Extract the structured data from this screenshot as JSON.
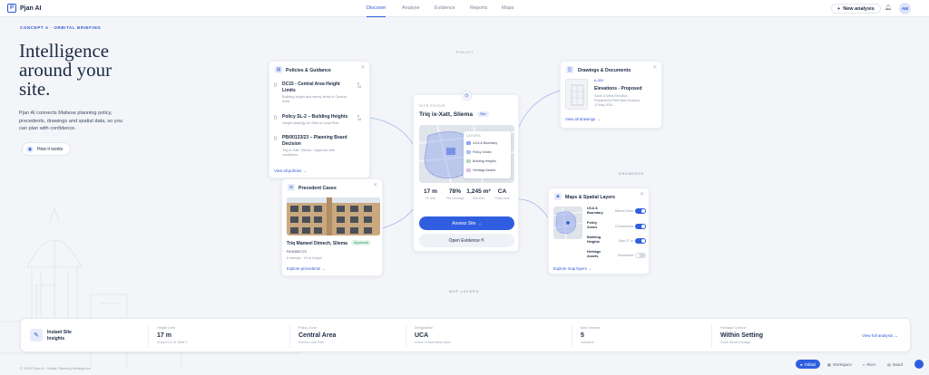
{
  "brand": {
    "name": "Pjan AI",
    "mark": "P"
  },
  "nav": [
    {
      "label": "Discover"
    },
    {
      "label": "Analyse"
    },
    {
      "label": "Evidence"
    },
    {
      "label": "Reports"
    },
    {
      "label": "Maps"
    }
  ],
  "header": {
    "new_analysis": "New analysis",
    "avatar": "AM"
  },
  "hero": {
    "eyebrow": "CONCEPT A · ORBITAL BRIEFING",
    "title": "Intelligence around your site.",
    "lede": "Pjan AI connects Maltese planning policy, precedents, drawings and spatial data, so you can plan with confidence.",
    "cta": "How it works"
  },
  "labels": {
    "policy": "POLICY",
    "drawings": "DRAWINGS",
    "map_layers": "MAP LAYERS"
  },
  "policies": {
    "title": "Policies & Guidance",
    "items": [
      {
        "title": "DC15 - Central Area Height Limits",
        "sub": "Building height and storey limits in Central Area",
        "tag": "p. 28"
      },
      {
        "title": "Policy SL-2 – Building Heights",
        "sub": "Height strategy for Sliema Local Plan",
        "tag": "p. 48"
      },
      {
        "title": "PB/00133/23 – Planning Board Decision",
        "sub": "Triq in-Xatt, Sliema · Approval with conditions",
        "tag": ""
      }
    ],
    "link": "View all policies"
  },
  "precedents": {
    "title": "Precedent Cases",
    "address": "Triq Manwel Dimech, Sliema",
    "status": "Approved",
    "ref": "PA/04587/23",
    "meta": "5 storeys · 15 m height",
    "link": "Explore precedents"
  },
  "site": {
    "eyebrow": "SITE FOCUS",
    "title": "Triq ix-Xatt, Sliema",
    "badge": "Site",
    "legend_title": "LAYERS",
    "layers": [
      {
        "name": "UCA & Boundary",
        "color": "#8fa6ee"
      },
      {
        "name": "Policy Zones",
        "color": "#a9c0f5"
      },
      {
        "name": "Building Heights",
        "color": "#b8d9c2"
      },
      {
        "name": "Heritage Assets",
        "color": "#d7bde8"
      }
    ],
    "stats": [
      {
        "value": "17 m",
        "label": "Ht. limit"
      },
      {
        "value": "78%",
        "label": "Plot coverage"
      },
      {
        "value": "1,245 m²",
        "label": "Site area"
      },
      {
        "value": "CA",
        "label": "Policy zone"
      }
    ],
    "primary": "Assess Site",
    "secondary": "Open Evidence"
  },
  "drawings": {
    "title": "Drawings & Documents",
    "ref": "A-300",
    "name": "Elevations - Proposed",
    "meta": "South & West Elevation",
    "by": "Prepared by Perit Mark Scicluna",
    "date": "12 May 2024",
    "link": "View all drawings"
  },
  "maps": {
    "title": "Maps & Spatial Layers",
    "layers": [
      {
        "name": "UCA & Boundary",
        "value": "Sliema Town",
        "on": true
      },
      {
        "name": "Policy Zones",
        "value": "Central Area",
        "on": true
      },
      {
        "name": "Building Heights",
        "value": "Max 17 m",
        "on": true
      },
      {
        "name": "Heritage Assets",
        "value": "Scheduled",
        "on": false
      }
    ],
    "link": "Explore map layers"
  },
  "insights": {
    "title": "Instant Site Insights",
    "cols": [
      {
        "label": "Height Limit",
        "value": "17 m",
        "sub": "Around DC15 Table 2"
      },
      {
        "label": "Policy Zone",
        "value": "Central Area",
        "sub": "Sliema Local Plan"
      },
      {
        "label": "Designation",
        "value": "UCA",
        "sub": "Urban Conservation Area"
      },
      {
        "label": "Max Storeys",
        "value": "5",
        "sub": "Indicative"
      },
      {
        "label": "Heritage Context",
        "value": "Within Setting",
        "sub": "South Street frontage"
      }
    ],
    "link": "View full analysis"
  },
  "footer": "© 2026 Pjan AI · Malta Planning Intelligence",
  "modes": [
    {
      "label": "Orbital"
    },
    {
      "label": "Workspace"
    },
    {
      "label": "River"
    },
    {
      "label": "Board"
    }
  ]
}
